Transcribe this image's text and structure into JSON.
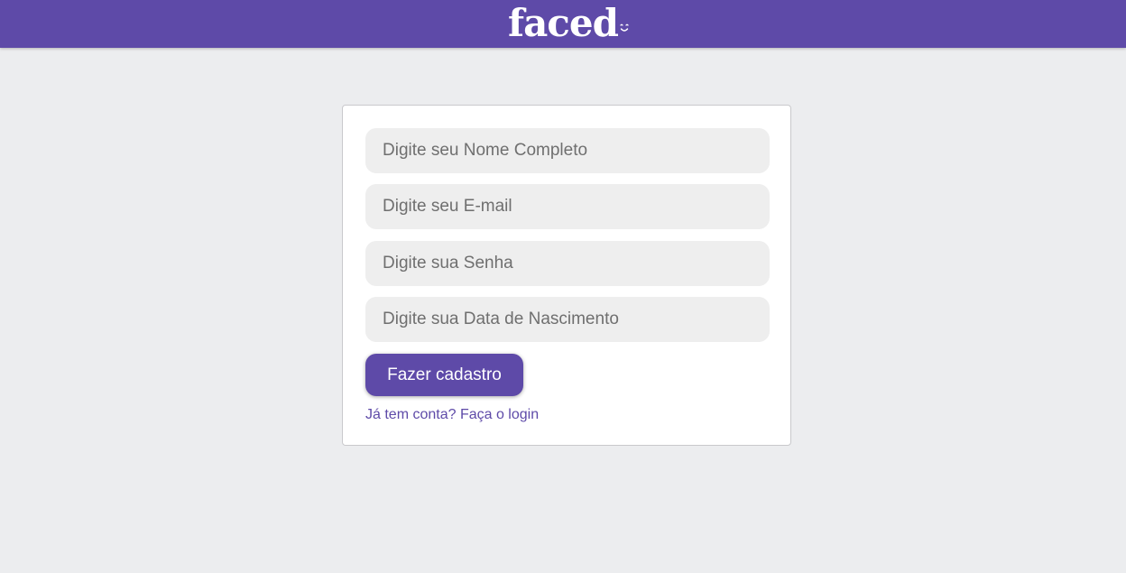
{
  "header": {
    "logo_text": "faced"
  },
  "form": {
    "name_placeholder": "Digite seu Nome Completo",
    "email_placeholder": "Digite seu E-mail",
    "password_placeholder": "Digite sua Senha",
    "birthdate_placeholder": "Digite sua Data de Nascimento",
    "submit_label": "Fazer cadastro",
    "login_link": "Já tem conta? Faça o login"
  },
  "colors": {
    "brand": "#5e4aa8",
    "background": "#ecedef",
    "field_bg": "#eeeeee"
  },
  "icons": {
    "logo_mark": "smile-icon"
  }
}
